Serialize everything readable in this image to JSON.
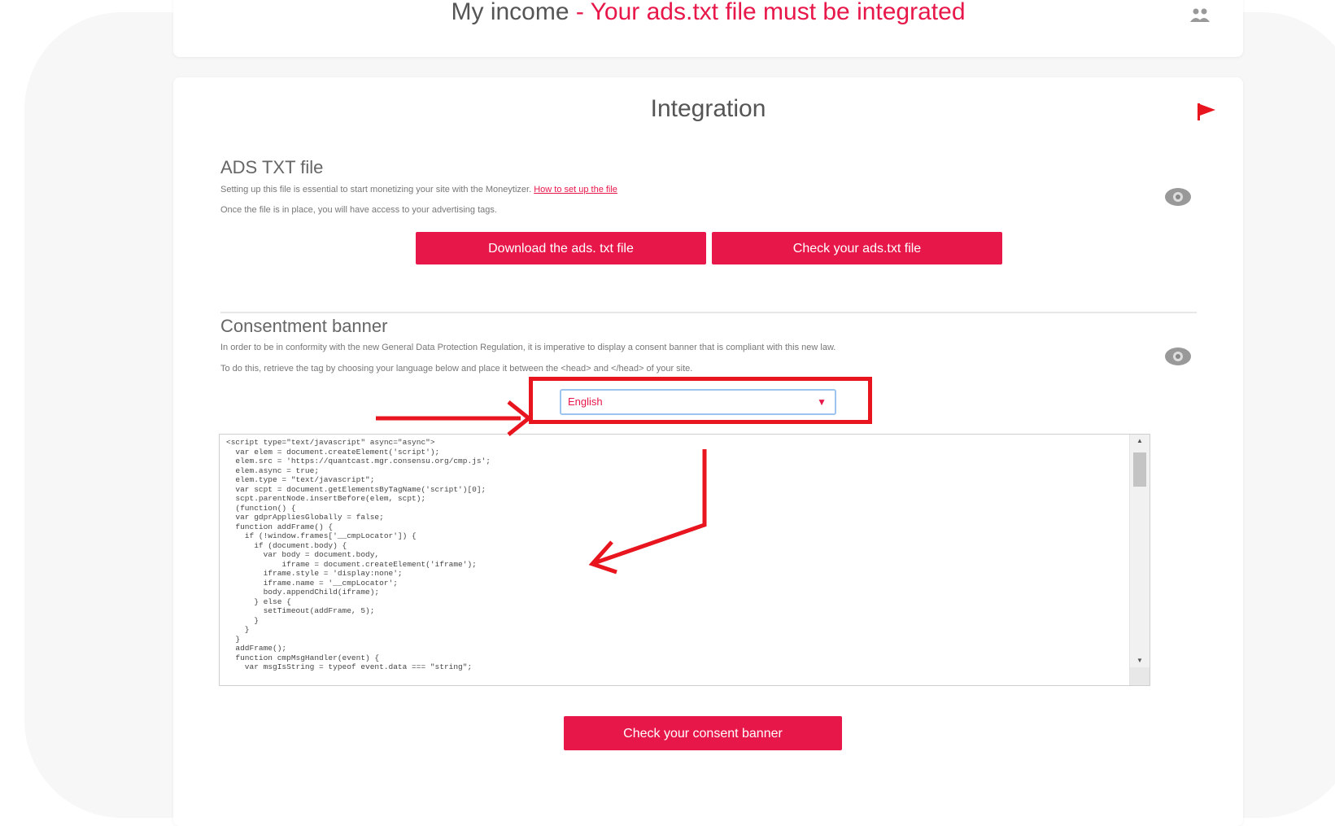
{
  "header": {
    "title": "My income",
    "separator": " - ",
    "warning": "Your ads.txt file must be integrated",
    "icon": "people-icon"
  },
  "integration": {
    "title": "Integration",
    "flag_icon": "red-flag-icon",
    "ads_txt": {
      "heading": "ADS TXT file",
      "text_line1": "Setting up this file is essential to start monetizing your site with the Moneytizer.",
      "link": "How to set up the file",
      "text_line2": "Once the file is in place, you will have access to your advertising tags.",
      "download_button": "Download the ads. txt file",
      "check_button": "Check your ads.txt file",
      "toggle_icon": "eye-icon"
    },
    "consent": {
      "heading": "Consentment banner",
      "text_line1": "In order to be in conformity with the new General Data Protection Regulation, it is imperative to display a consent banner that is compliant with this new law.",
      "text_line2": "To do this, retrieve the tag by choosing your language below and place it between the <head> and </head> of your site.",
      "language_select": "English",
      "toggle_icon": "eye-icon",
      "code": "<script type=\"text/javascript\" async=\"async\">\n  var elem = document.createElement('script');\n  elem.src = 'https://quantcast.mgr.consensu.org/cmp.js';\n  elem.async = true;\n  elem.type = \"text/javascript\";\n  var scpt = document.getElementsByTagName('script')[0];\n  scpt.parentNode.insertBefore(elem, scpt);\n  (function() {\n  var gdprAppliesGlobally = false;\n  function addFrame() {\n    if (!window.frames['__cmpLocator']) {\n      if (document.body) {\n        var body = document.body,\n            iframe = document.createElement('iframe');\n        iframe.style = 'display:none';\n        iframe.name = '__cmpLocator';\n        body.appendChild(iframe);\n      } else {\n        setTimeout(addFrame, 5);\n      }\n    }\n  }\n  addFrame();\n  function cmpMsgHandler(event) {\n    var msgIsString = typeof event.data === \"string\";",
      "check_button": "Check your consent banner"
    }
  },
  "colors": {
    "accent": "#e8174a",
    "annotation": "#e8141e"
  }
}
